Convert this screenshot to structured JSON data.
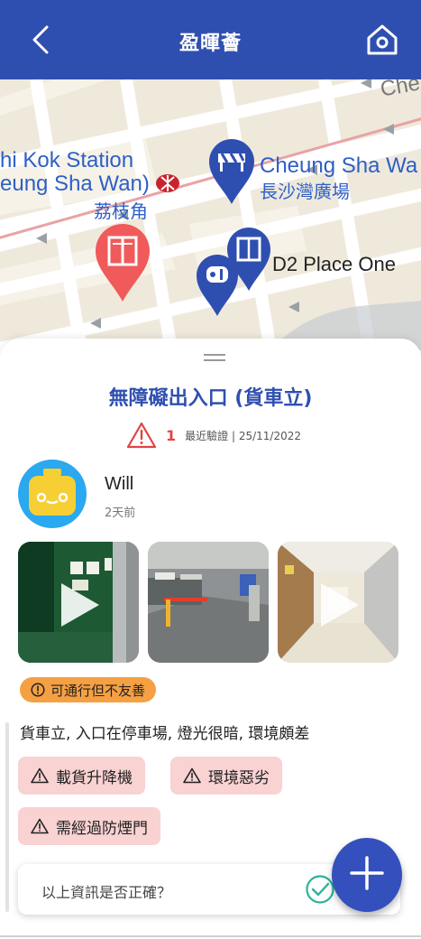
{
  "header": {
    "title": "盈暉薈",
    "back_icon": "chevron-left-icon",
    "home_icon": "home-icon",
    "color": "#2f4fb0"
  },
  "map": {
    "labels": {
      "station_en_1": "hi Kok Station",
      "station_en_2": "eung Sha Wan)",
      "station_cn": "荔枝角",
      "plaza_en": "Cheung Sha Wa",
      "plaza_cn": "長沙灣廣場",
      "d2_place": "D2 Place One",
      "road_fragment": "Che"
    },
    "pins": [
      {
        "icon": "elevator-icon",
        "color": "#f05a5a",
        "selected": true
      },
      {
        "icon": "barrier-icon",
        "color": "#2f4fb0"
      },
      {
        "icon": "elevator-icon",
        "color": "#2f4fb0"
      },
      {
        "icon": "toilet-icon",
        "color": "#2f4fb0"
      }
    ]
  },
  "detail": {
    "title": "無障礙出入口 (貨車立)",
    "warning_count": "1",
    "verified_text": "最近驗證 | 25/11/2022",
    "user": {
      "name": "Will",
      "time_ago": "2天前"
    },
    "status": {
      "label": "可通行但不友善",
      "color": "#f5a043"
    },
    "description": "貨車立, 入口在停車場, 燈光很暗, 環境頗差",
    "tags": [
      {
        "label": "載貨升降機"
      },
      {
        "label": "環境惡劣"
      },
      {
        "label": "需經過防煙門"
      }
    ],
    "confirm": {
      "question": "以上資訊是否正確？"
    }
  },
  "colors": {
    "primary": "#2f4fb0",
    "tag_bg": "#f9d2d2",
    "warning": "#e04444",
    "check": "#2bb39a"
  }
}
